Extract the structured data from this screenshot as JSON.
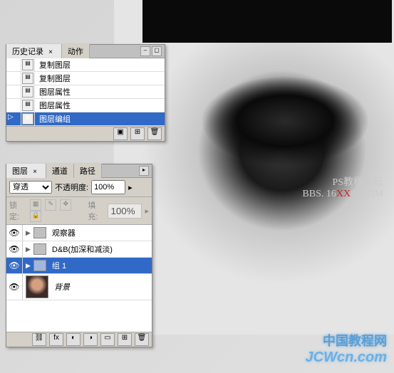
{
  "history_panel": {
    "tabs": [
      "历史记录",
      "动作"
    ],
    "items": [
      {
        "label": "复制图层",
        "active": false
      },
      {
        "label": "复制图层",
        "active": false
      },
      {
        "label": "图层属性",
        "active": false
      },
      {
        "label": "图层属性",
        "active": false
      },
      {
        "label": "图层编组",
        "active": true
      }
    ]
  },
  "layers_panel": {
    "tabs": [
      "图层",
      "通道",
      "路径"
    ],
    "blend_mode": "穿透",
    "opacity_label": "不透明度:",
    "opacity_value": "100%",
    "lock_label": "锁定:",
    "fill_label": "填充:",
    "fill_value": "100%",
    "layers": [
      {
        "label": "观察器",
        "type": "folder",
        "selected": false
      },
      {
        "label": "D&B(加深和减淡)",
        "type": "folder",
        "selected": false
      },
      {
        "label": "组 1",
        "type": "folder",
        "selected": true
      },
      {
        "label": "背景",
        "type": "image",
        "selected": false
      }
    ]
  },
  "watermark": {
    "line1": "PS教程论坛",
    "line2_a": "BBS. 16",
    "line2_b": "XX",
    "line2_c": "8. COM",
    "brand_cn": "中国教程网",
    "brand_url": "JCWcn.com"
  }
}
